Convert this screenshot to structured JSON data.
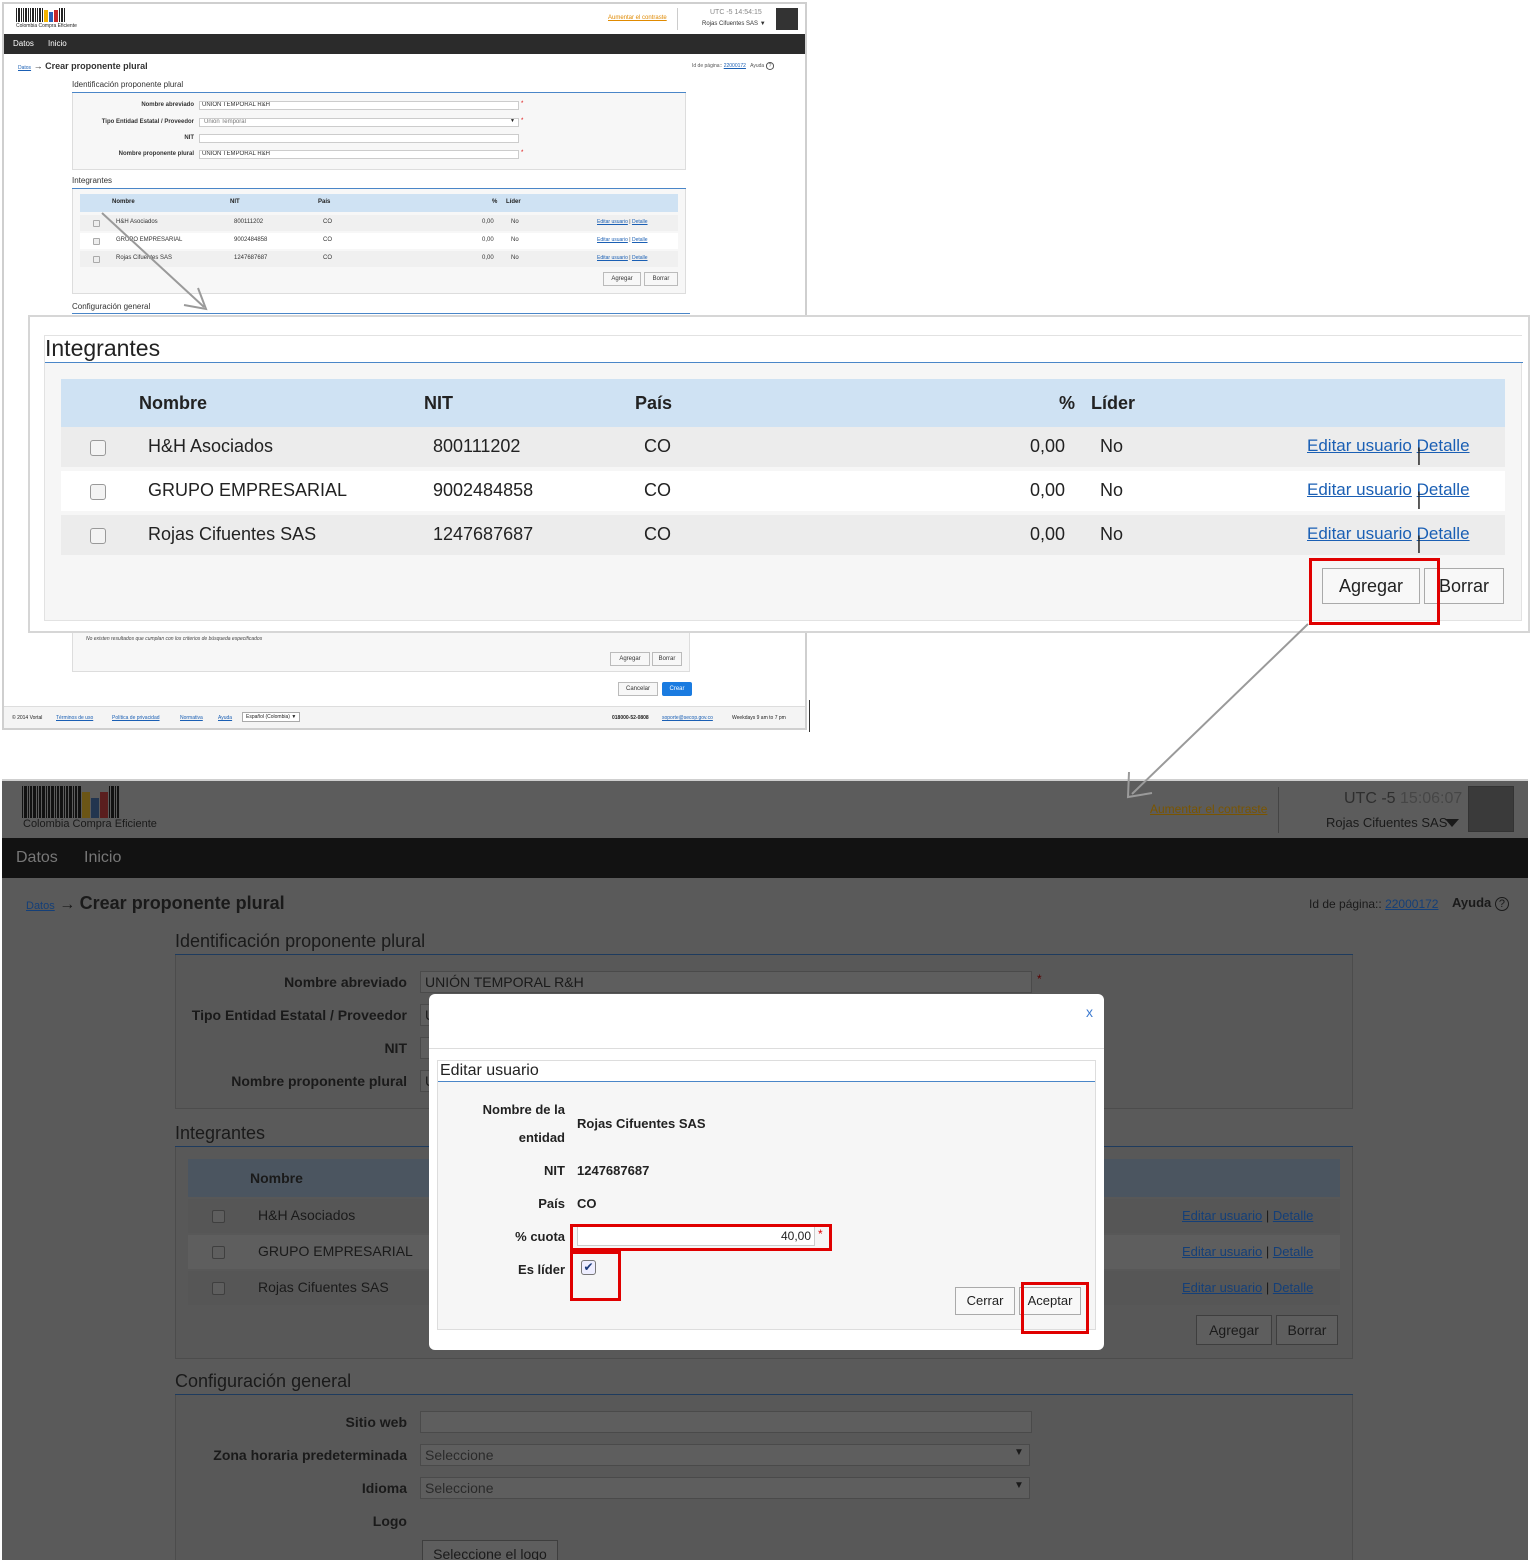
{
  "header": {
    "logo_text": "Colombia Compra Eficiente",
    "contrast_link": "Aumentar el contraste",
    "utc_label": "UTC -5",
    "time_small": "14:54:15",
    "time_large": "15:06:07",
    "user": "Rojas Cifuentes SAS"
  },
  "nav": {
    "datos": "Datos",
    "inicio": "Inicio"
  },
  "breadcrumb": {
    "root": "Datos",
    "arrow": "→",
    "title": "Crear proponente plural"
  },
  "page_id": {
    "label": "Id de página::",
    "value": "22000172",
    "help": "Ayuda",
    "help_icon": "?"
  },
  "identificacion": {
    "title": "Identificación proponente plural",
    "nombre_abreviado_label": "Nombre abreviado",
    "nombre_abreviado_value": "UNIÓN TEMPORAL R&H",
    "tipo_label": "Tipo Entidad Estatal / Proveedor",
    "tipo_value": "Unión Temporal",
    "nit_label": "NIT",
    "nit_value": "",
    "nombre_plural_label": "Nombre proponente plural",
    "nombre_plural_value": "UNIÓN TEMPORAL R&H",
    "nombre_plural_value_truncated": "U",
    "tipo_value_truncated": "U",
    "required_mark": "*"
  },
  "integrantes": {
    "title": "Integrantes",
    "columns": {
      "nombre": "Nombre",
      "nit": "NIT",
      "pais": "País",
      "pct": "%",
      "lider": "Líder"
    },
    "rows": [
      {
        "nombre": "H&H Asociados",
        "nit": "800111202",
        "pais": "CO",
        "pct": "0,00",
        "lider": "No"
      },
      {
        "nombre": "GRUPO EMPRESARIAL",
        "nit": "9002484858",
        "pais": "CO",
        "pct": "0,00",
        "lider": "No"
      },
      {
        "nombre": "Rojas Cifuentes SAS",
        "nit": "1247687687",
        "pais": "CO",
        "pct": "0,00",
        "lider": "No"
      }
    ],
    "edit_link": "Editar usuario",
    "link_sep": "|",
    "detail_link": "Detalle",
    "add_button": "Agregar",
    "delete_button": "Borrar"
  },
  "configuracion": {
    "title": "Configuración general",
    "sitio_web_label": "Sitio web",
    "zona_label": "Zona horaria predeterminada",
    "zona_value": "Seleccione",
    "idioma_label": "Idioma",
    "idioma_value": "Seleccione",
    "logo_label": "Logo",
    "logo_button": "Seleccione el logo"
  },
  "otros": {
    "no_results": "No existen resultados que cumplan con los criterios de búsqueda especificados",
    "add_button": "Agregar",
    "delete_button": "Borrar",
    "cancel_button": "Cancelar",
    "create_button": "Crear"
  },
  "footer": {
    "copyright": "© 2014 Vortal",
    "terms": "Términos de uso",
    "privacy": "Política de privacidad",
    "rules": "Normativa",
    "help": "Ayuda",
    "language": "Español (Colombia)",
    "phone": "018000-52-0808",
    "email": "soporte@secop.gov.co",
    "hours": "Weekdays 9 am to 7 pm"
  },
  "modal": {
    "close": "x",
    "title": "Editar usuario",
    "entity_label_1": "Nombre de la",
    "entity_label_2": "entidad",
    "entity_value": "Rojas Cifuentes SAS",
    "nit_label": "NIT",
    "nit_value": "1247687687",
    "pais_label": "País",
    "pais_value": "CO",
    "cuota_label": "% cuota",
    "cuota_value": "40,00",
    "required_mark": "*",
    "lider_label": "Es líder",
    "lider_checked": true,
    "cerrar_button": "Cerrar",
    "aceptar_button": "Aceptar"
  },
  "icons": {
    "dropdown": "▼",
    "checkmark": "✔"
  },
  "colors": {
    "highlight": "#e00000",
    "link": "#1a5fb4",
    "table_header": "#cfe2f3",
    "nav_bg": "#2b2b2b",
    "primary_button": "#1a7be0",
    "contrast_link": "#e08a00"
  }
}
